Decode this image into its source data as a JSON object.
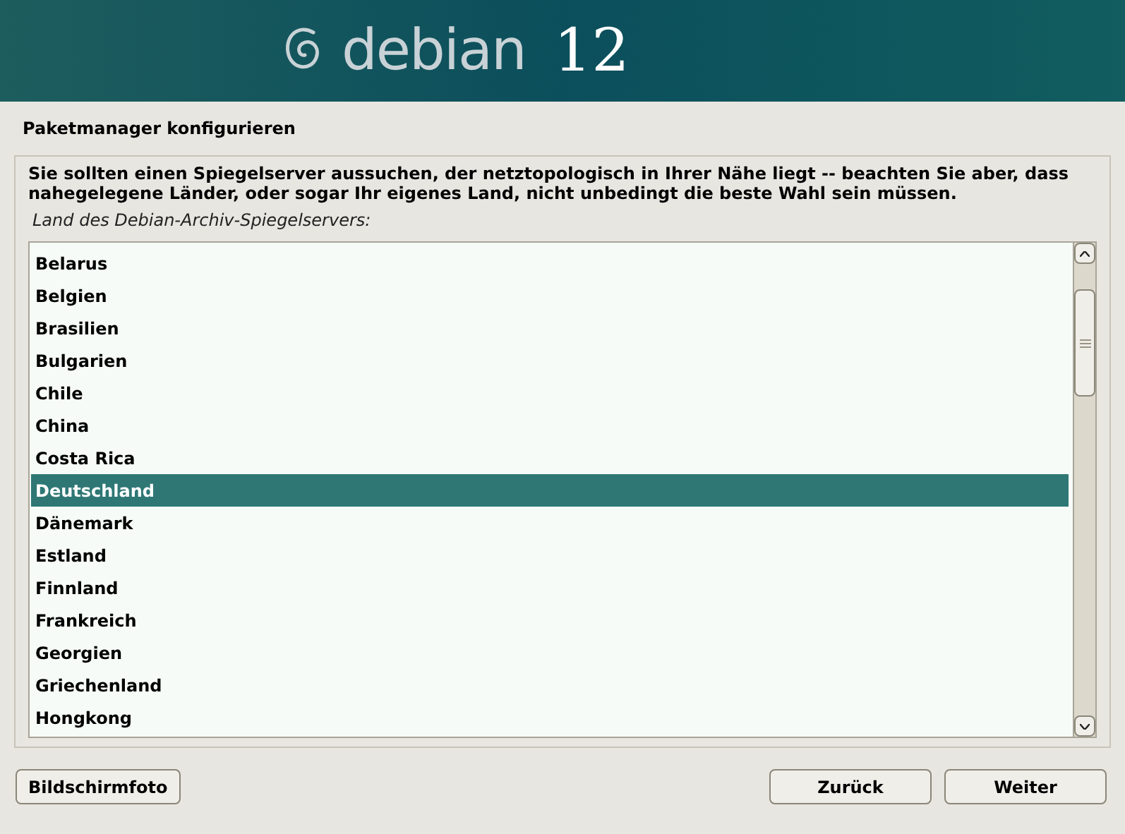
{
  "banner": {
    "logo_text": "debian",
    "version": "12"
  },
  "title": "Paketmanager konfigurieren",
  "description": "Sie sollten einen Spiegelserver aussuchen, der netztopologisch in Ihrer Nähe liegt -- beachten Sie aber, dass nahegelegene Länder, oder sogar Ihr eigenes Land, nicht unbedingt die beste Wahl sein müssen.",
  "list_label": "Land des Debian-Archiv-Spiegelservers:",
  "countries": [
    {
      "label": "Belarus",
      "selected": false
    },
    {
      "label": "Belgien",
      "selected": false
    },
    {
      "label": "Brasilien",
      "selected": false
    },
    {
      "label": "Bulgarien",
      "selected": false
    },
    {
      "label": "Chile",
      "selected": false
    },
    {
      "label": "China",
      "selected": false
    },
    {
      "label": "Costa Rica",
      "selected": false
    },
    {
      "label": "Deutschland",
      "selected": true
    },
    {
      "label": "Dänemark",
      "selected": false
    },
    {
      "label": "Estland",
      "selected": false
    },
    {
      "label": "Finnland",
      "selected": false
    },
    {
      "label": "Frankreich",
      "selected": false
    },
    {
      "label": "Georgien",
      "selected": false
    },
    {
      "label": "Griechenland",
      "selected": false
    },
    {
      "label": "Hongkong",
      "selected": false
    }
  ],
  "buttons": {
    "screenshot": "Bildschirmfoto",
    "back": "Zurück",
    "next": "Weiter"
  }
}
